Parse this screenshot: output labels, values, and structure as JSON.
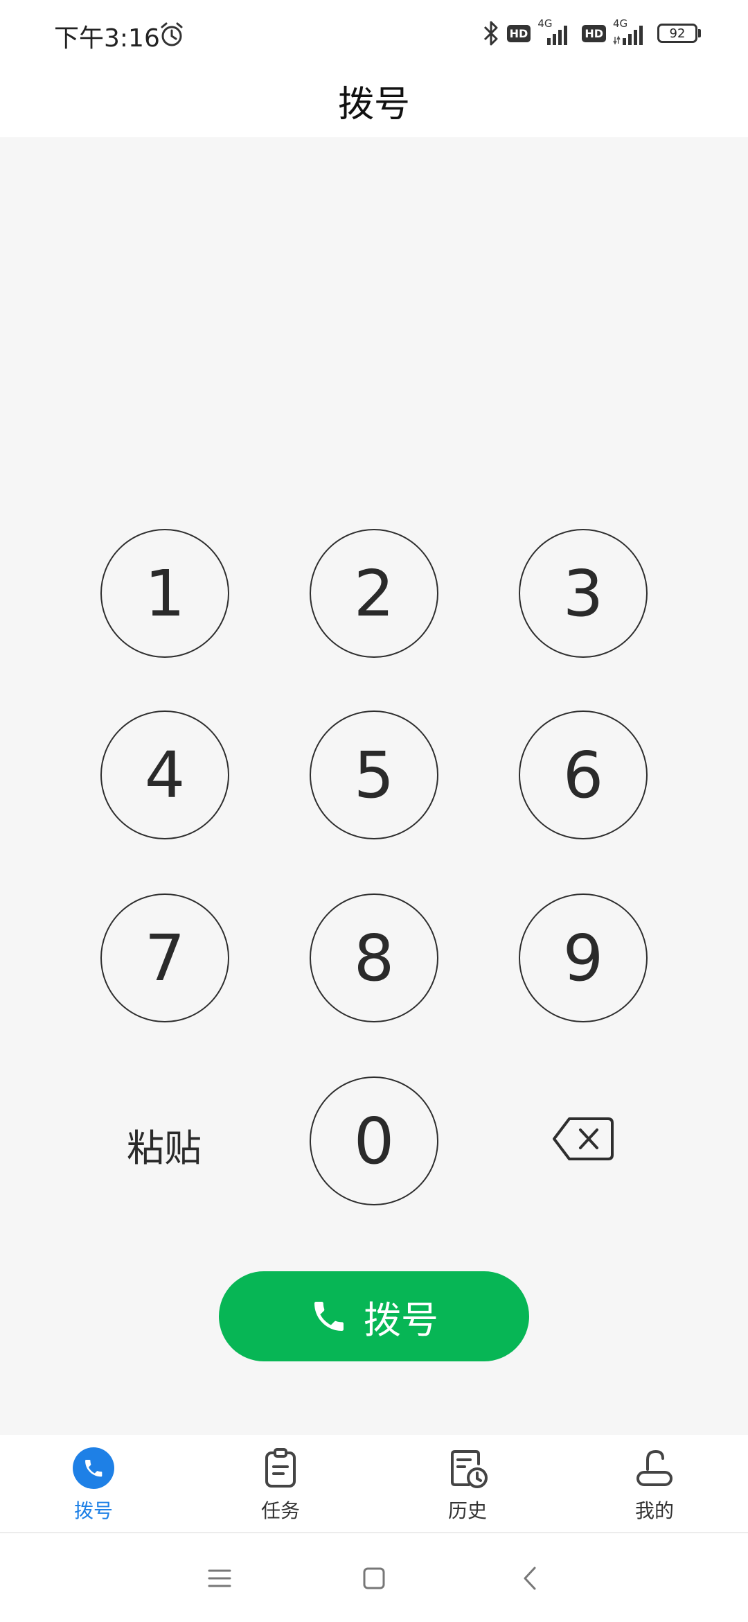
{
  "status_bar": {
    "time": "下午3:16",
    "hd_badge_1": "HD",
    "network_1": "4G",
    "hd_badge_2": "HD",
    "network_2": "4G",
    "battery": "92"
  },
  "header": {
    "title": "拨号"
  },
  "keypad": {
    "keys": [
      "1",
      "2",
      "3",
      "4",
      "5",
      "6",
      "7",
      "8",
      "9",
      "0"
    ],
    "paste_label": "粘贴"
  },
  "call_button": {
    "label": "拨号"
  },
  "tabs": [
    {
      "label": "拨号",
      "icon": "phone-icon",
      "active": true
    },
    {
      "label": "任务",
      "icon": "clipboard-icon",
      "active": false
    },
    {
      "label": "历史",
      "icon": "history-icon",
      "active": false
    },
    {
      "label": "我的",
      "icon": "profile-icon",
      "active": false
    }
  ],
  "colors": {
    "accent": "#1e80e6",
    "call_green": "#07b655",
    "background": "#f6f6f6"
  }
}
